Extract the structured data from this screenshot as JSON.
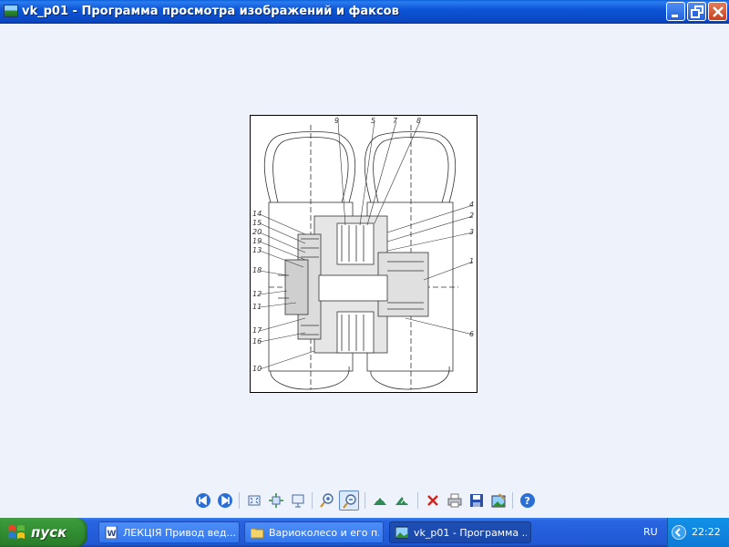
{
  "window": {
    "title": "vk_p01 - Программа просмотра изображений и факсов",
    "icon": "image-viewer-icon"
  },
  "drawing": {
    "callouts": [
      "9",
      "5",
      "7",
      "8",
      "4",
      "2",
      "3",
      "1",
      "6",
      "14",
      "15",
      "20",
      "19",
      "13",
      "18",
      "12",
      "11",
      "17",
      "16",
      "10"
    ]
  },
  "toolbar": {
    "buttons": [
      "previous-image",
      "next-image",
      "best-fit",
      "actual-size",
      "start-slideshow",
      "zoom-in",
      "zoom-out",
      "rotate-clockwise",
      "rotate-counterclockwise",
      "delete",
      "print",
      "copy-to",
      "open-for-editing",
      "help"
    ]
  },
  "taskbar": {
    "start_label": "пуск",
    "tasks": [
      {
        "label": "ЛЕКЦІЯ Привод вед...",
        "icon": "word-document-icon"
      },
      {
        "label": "Вариоколесо и его п...",
        "icon": "folder-icon"
      },
      {
        "label": "vk_p01 - Программа ...",
        "icon": "image-viewer-icon"
      }
    ],
    "language": "RU",
    "clock": "22:22"
  },
  "colors": {
    "titlebar": "#0a48c4",
    "taskbar": "#245edb",
    "start": "#3a9a3a",
    "tray": "#0e7ad6",
    "background": "#eef2fb"
  }
}
